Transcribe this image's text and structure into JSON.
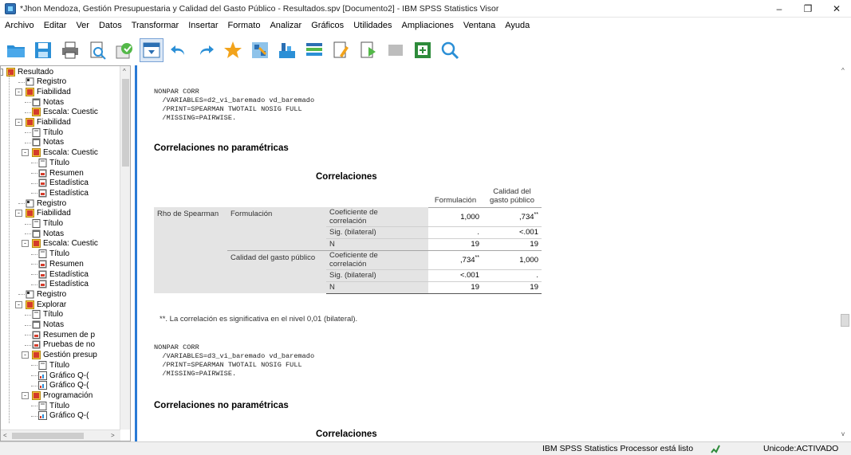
{
  "window": {
    "title": "*Jhon Mendoza, Gestión Presupuestaria y Calidad del Gasto Público - Resultados.spv [Documento2] - IBM SPSS Statistics Visor",
    "minimize": "–",
    "maximize": "❐",
    "close": "✕"
  },
  "menu": [
    "Archivo",
    "Editar",
    "Ver",
    "Datos",
    "Transformar",
    "Insertar",
    "Formato",
    "Analizar",
    "Gráficos",
    "Utilidades",
    "Ampliaciones",
    "Ventana",
    "Ayuda"
  ],
  "toolbar": {
    "icons": [
      "open-folder-icon",
      "save-icon",
      "print-icon",
      "print-preview-icon",
      "export-icon",
      "designate-window-icon",
      "undo-icon",
      "redo-icon",
      "goto-data-icon",
      "goto-case-icon",
      "goto-variable-icon",
      "variables-icon",
      "show-all-variables-icon",
      "insert-output-icon",
      "promote-icon",
      "demote-icon",
      "insert-heading-icon",
      "find-icon"
    ]
  },
  "tree": [
    {
      "label": "Resultado",
      "type": "book"
    },
    {
      "label": "Registro",
      "type": "log"
    },
    {
      "label": "Fiabilidad",
      "type": "book"
    },
    {
      "label": "Notas",
      "type": "notes"
    },
    {
      "label": "Escala: Cuestic",
      "type": "book"
    },
    {
      "label": "Fiabilidad",
      "type": "book"
    },
    {
      "label": "Título",
      "type": "title"
    },
    {
      "label": "Notas",
      "type": "notes"
    },
    {
      "label": "Escala: Cuestic",
      "type": "book"
    },
    {
      "label": "Título",
      "type": "title"
    },
    {
      "label": "Resumen",
      "type": "table"
    },
    {
      "label": "Estadística",
      "type": "table"
    },
    {
      "label": "Estadística",
      "type": "table"
    },
    {
      "label": "Registro",
      "type": "log"
    },
    {
      "label": "Fiabilidad",
      "type": "book"
    },
    {
      "label": "Título",
      "type": "title"
    },
    {
      "label": "Notas",
      "type": "notes"
    },
    {
      "label": "Escala: Cuestic",
      "type": "book"
    },
    {
      "label": "Título",
      "type": "title"
    },
    {
      "label": "Resumen",
      "type": "table"
    },
    {
      "label": "Estadística",
      "type": "table"
    },
    {
      "label": "Estadística",
      "type": "table"
    },
    {
      "label": "Registro",
      "type": "log"
    },
    {
      "label": "Explorar",
      "type": "book"
    },
    {
      "label": "Título",
      "type": "title"
    },
    {
      "label": "Notas",
      "type": "notes"
    },
    {
      "label": "Resumen de p",
      "type": "table"
    },
    {
      "label": "Pruebas de no",
      "type": "table"
    },
    {
      "label": "Gestión presup",
      "type": "book"
    },
    {
      "label": "Título",
      "type": "title"
    },
    {
      "label": "Gráfico Q-(",
      "type": "chart"
    },
    {
      "label": "Gráfico Q-(",
      "type": "chart"
    },
    {
      "label": "Programación",
      "type": "book"
    },
    {
      "label": "Título",
      "type": "title"
    },
    {
      "label": "Gráfico Q-(",
      "type": "chart"
    }
  ],
  "syntax1": "NONPAR CORR\n  /VARIABLES=d2_vi_baremado vd_baremado\n  /PRINT=SPEARMAN TWOTAIL NOSIG FULL\n  /MISSING=PAIRWISE.",
  "syntax2": "NONPAR CORR\n  /VARIABLES=d3_vi_baremado vd_baremado\n  /PRINT=SPEARMAN TWOTAIL NOSIG FULL\n  /MISSING=PAIRWISE.",
  "section_heading": "Correlaciones no paramétricas",
  "table_title": "Correlaciones",
  "table": {
    "col1": "Formulación",
    "col2a": "Calidad del",
    "col2b": "gasto público",
    "rho": "Rho de Spearman",
    "var1": "Formulación",
    "var2": "Calidad del gasto público",
    "coef_a": "Coeficiente de",
    "coef_b": "correlación",
    "sig": "Sig. (bilateral)",
    "n": "N",
    "r1c1": "1,000",
    "r1c2": ",734",
    "r2c1": ".",
    "r2c2": "<.001",
    "r3c1": "19",
    "r3c2": "19",
    "r4c1": ",734",
    "r4c2": "1,000",
    "r5c1": "<.001",
    "r5c2": ".",
    "r6c1": "19",
    "r6c2": "19",
    "stars": "**"
  },
  "footnote": "**. La correlación es significativa en el nivel 0,01 (bilateral).",
  "status": {
    "processor": "IBM SPSS Statistics Processor está listo",
    "unicode": "Unicode:ACTIVADO"
  }
}
